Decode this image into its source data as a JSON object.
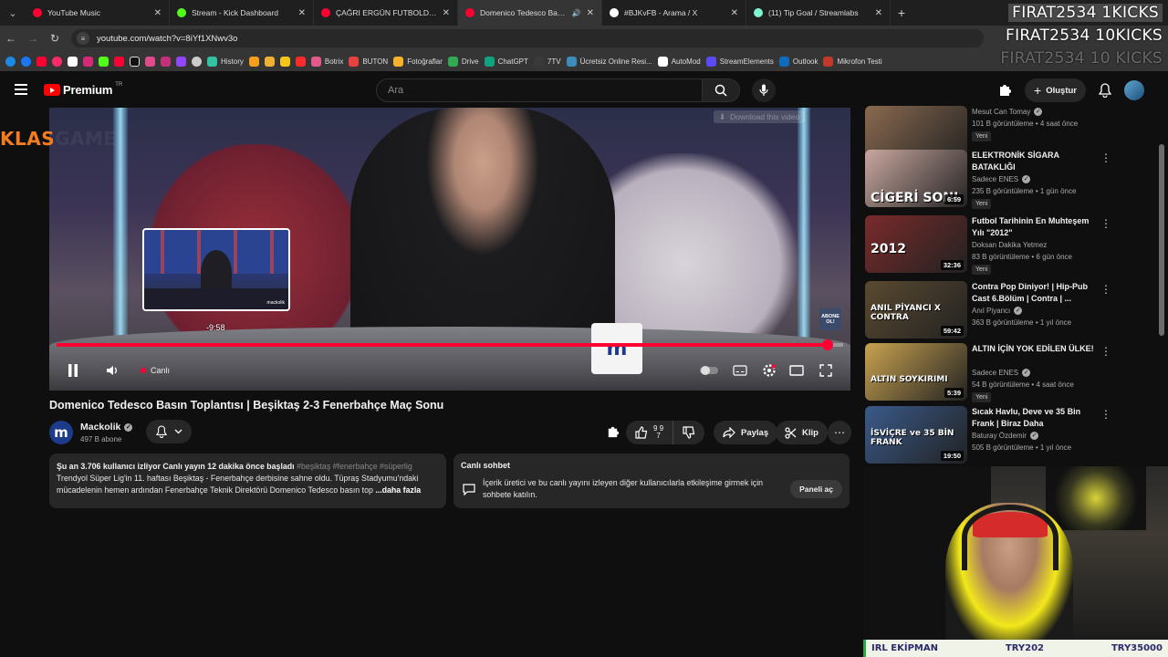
{
  "browser": {
    "tabs": [
      {
        "label": "YouTube Music",
        "color": "#ff0033"
      },
      {
        "label": "Stream - Kick Dashboard",
        "color": "#53fc18"
      },
      {
        "label": "ÇAĞRI ERGÜN FUTBOLDA NE K",
        "color": "#ff0033"
      },
      {
        "label": "Domenico Tedesco Basın To",
        "color": "#ff0033",
        "active": true
      },
      {
        "label": "#BJKvFB - Arama / X",
        "color": "#ffffff"
      },
      {
        "label": "(11) Tip Goal / Streamlabs",
        "color": "#80f5d2"
      }
    ],
    "url": "youtube.com/watch?v=8iYf1XNwv3o",
    "bookmarks": [
      {
        "label": "History",
        "color": "#31c3a2"
      },
      {
        "label": "",
        "color": "#f4a01c"
      },
      {
        "label": "",
        "color": "#f0b030"
      },
      {
        "label": "",
        "color": "#f5c518"
      },
      {
        "label": "",
        "color": "#ff2a2a"
      },
      {
        "label": "Botrix",
        "color": "#e05a8a"
      },
      {
        "label": "BUTON",
        "color": "#e94040"
      },
      {
        "label": "Fotoğraflar",
        "color": "#f7b32b"
      },
      {
        "label": "Drive",
        "color": "#34a853"
      },
      {
        "label": "ChatGPT",
        "color": "#10a37f"
      },
      {
        "label": "7TV",
        "color": "#3a3a3a"
      },
      {
        "label": "Ücretsiz Online Resi...",
        "color": "#3c8dbc"
      },
      {
        "label": "AutoMod",
        "color": "#ffffff"
      },
      {
        "label": "StreamElements",
        "color": "#5b4af7"
      },
      {
        "label": "Outlook",
        "color": "#0f6cbd"
      },
      {
        "label": "Mikrofon Testi",
        "color": "#c0392b"
      }
    ]
  },
  "overlay": {
    "line1": "FIRAT2534 1KICKS",
    "line2": "FIRAT2534 10KICKS",
    "line3": "FIRAT2534 10 KICKS"
  },
  "header": {
    "brand": "Premium",
    "region": "TR",
    "search_placeholder": "Ara",
    "create_label": "Oluştur"
  },
  "player": {
    "channel_logo_text_1": "KLAS",
    "channel_logo_text_2": "GAME",
    "download_label": "Download this video",
    "subscribe_badge": "ABONE OL!",
    "preview_time": "-9:58",
    "live_label": "Canlı",
    "mug_letter": "m",
    "preview_tag": "mackolik",
    "progress_fraction": 0.98
  },
  "video": {
    "title": "Domenico Tedesco Basın Toplantısı | Beşiktaş 2-3 Fenerbahçe Maç Sonu",
    "channel": "Mackolik",
    "channel_initial": "m",
    "subscribers": "497 B abone",
    "like_count_top": "9 9",
    "like_count_bottom": "7",
    "share_label": "Paylaş",
    "clip_label": "Klip"
  },
  "description": {
    "stats": "Şu an 3.706 kullanıcı izliyor  Canlı yayın 12 dakika önce başladı",
    "tags": "#beşiktaş #fenerbahçe #süperlig",
    "body": "Trendyol Süper Lig'in 11. haftası Beşiktaş - Fenerbahçe derbisine sahne oldu. Tüpraş Stadyumu'ndaki mücadelenin hemen ardından Fenerbahçe Teknik Direktörü Domenico Tedesco basın top",
    "more": "...daha fazla"
  },
  "live_chat": {
    "title": "Canlı sohbet",
    "text": "İçerik üretici ve bu canlı yayını izleyen diğer kullanıcılarla etkileşime girmek için sohbete katılın.",
    "button": "Paneli aç"
  },
  "recommendations": [
    {
      "title": "",
      "channel": "Mesut Can Tomay",
      "verified": true,
      "meta": "101 B görüntüleme • 4 saat önce",
      "new": "Yeni",
      "duration": "40:01",
      "thumb_text": "",
      "thumb_bg": "#8a6a50"
    },
    {
      "title": "ELEKTRONİK SİGARA BATAKLIĞI",
      "channel": "Sadece ENES",
      "verified": true,
      "meta": "235 B görüntüleme • 1 gün önce",
      "new": "Yeni",
      "duration": "6:59",
      "thumb_text": "CİGERİ SONI",
      "thumb_bg": "#c9a7a0"
    },
    {
      "title": "Futbol Tarihinin En Muhteşem Yılı \"2012\"",
      "channel": "Doksan Dakika Yetmez",
      "verified": false,
      "meta": "83 B görüntüleme • 6 gün önce",
      "new": "Yeni",
      "duration": "32:36",
      "thumb_text": "2012",
      "thumb_bg": "#7a2a2a"
    },
    {
      "title": "Contra Pop Diniyor! | Hip-Pub Cast 6.Bölüm | Contra | ...",
      "channel": "Anıl Piyancı",
      "verified": true,
      "meta": "363 B görüntüleme • 1 yıl önce",
      "new": "",
      "duration": "59:42",
      "thumb_text": "ANIL PİYANCI X CONTRA",
      "thumb_bg": "#5a4a30"
    },
    {
      "title": "ALTIN İÇİN YOK EDİLEN ÜLKE!",
      "channel": "Sadece ENES",
      "verified": true,
      "meta": "54 B görüntüleme • 4 saat önce",
      "new": "Yeni",
      "duration": "5:39",
      "thumb_text": "ALTIN SOYKIRIMI",
      "thumb_bg": "#c9a350"
    },
    {
      "title": "Sıcak Havlu, Deve ve 35 Bin Frank | Biraz Daha",
      "channel": "Baturay Özdemir",
      "verified": true,
      "meta": "505 B görüntüleme • 1 yıl önce",
      "new": "",
      "duration": "19:50",
      "thumb_text": "İSVİÇRE ve 35 BİN FRANK",
      "thumb_bg": "#3a5a8a"
    }
  ],
  "stream_bar": {
    "left": "IRL EKİPMAN",
    "center": "TRY202",
    "right": "TRY35000"
  }
}
